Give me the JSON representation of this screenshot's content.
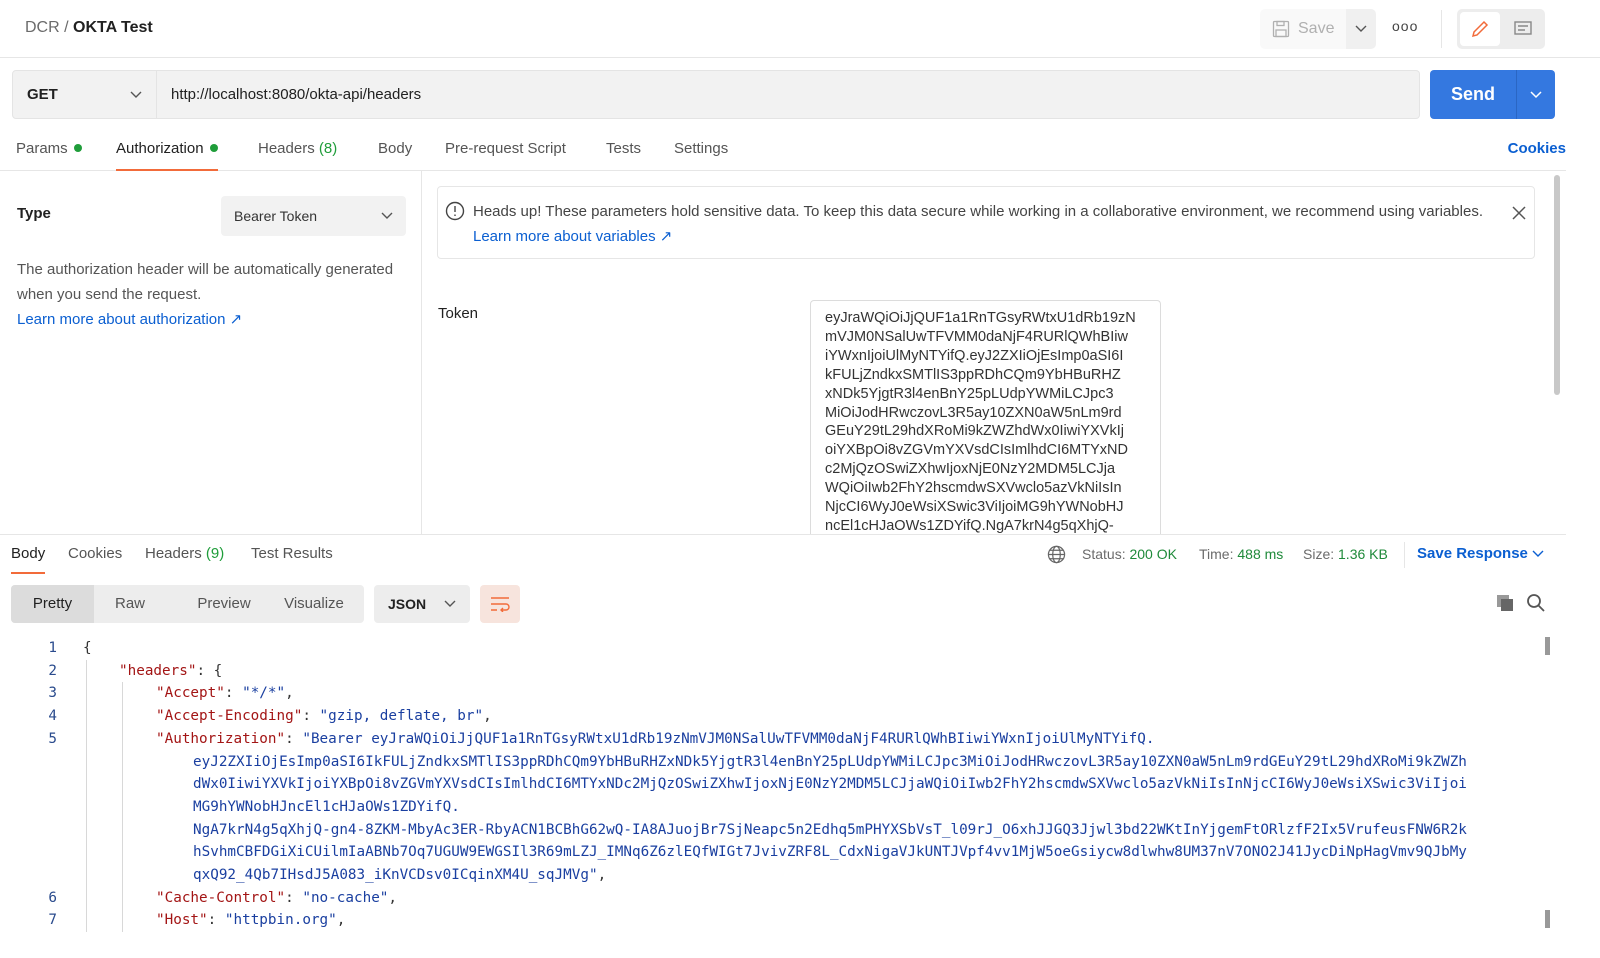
{
  "header": {
    "breadcrumb_parent": "DCR",
    "breadcrumb_sep": "/",
    "title": "OKTA Test",
    "save_label": "Save",
    "more_label": "ooo"
  },
  "request": {
    "method": "GET",
    "url": "http://localhost:8080/okta-api/headers",
    "send_label": "Send"
  },
  "tabs": [
    {
      "label": "Params",
      "dot": true
    },
    {
      "label": "Authorization",
      "dot": true,
      "active": true
    },
    {
      "label": "Headers",
      "count": "(8)"
    },
    {
      "label": "Body"
    },
    {
      "label": "Pre-request Script"
    },
    {
      "label": "Tests"
    },
    {
      "label": "Settings"
    }
  ],
  "cookies_label": "Cookies",
  "auth": {
    "type_label": "Type",
    "type_value": "Bearer Token",
    "description": "The authorization header will be automatically generated when you send the request.",
    "learn_more": "Learn more about authorization ↗",
    "alert_text": "Heads up! These parameters hold sensitive data. To keep this data secure while working in a collaborative environment, we recommend using variables.",
    "alert_link": "Learn more about variables ↗",
    "token_label": "Token",
    "token_lines": [
      "eyJraWQiOiJjQUF1a1RnTGsyRWtxU1dRb19zN",
      "mVJM0NSalUwTFVMM0daNjF4RURlQWhBIiw",
      "iYWxnIjoiUlMyNTYifQ.eyJ2ZXIiOjEsImp0aSI6I",
      "kFULjZndkxSMTlIS3ppRDhCQm9YbHBuRHZ",
      "xNDk5YjgtR3l4enBnY25pLUdpYWMiLCJpc3",
      "MiOiJodHRwczovL3R5ay10ZXN0aW5nLm9rd",
      "GEuY29tL29hdXRoMi9kZWZhdWx0IiwiYXVkIj",
      "oiYXBpOi8vZGVmYXVsdCIsImlhdCI6MTYxND",
      "c2MjQzOSwiZXhwIjoxNjE0NzY2MDM5LCJja",
      "WQiOiIwb2FhY2hscmdwSXVwclo5azVkNiIsIn",
      "NjcCI6WyJ0eWsiXSwic3ViIjoiMG9hYWNobHJ",
      "ncEl1cHJaOWs1ZDYifQ.NgA7krN4g5qXhjQ-"
    ]
  },
  "response": {
    "tabs": [
      {
        "label": "Body",
        "active": true
      },
      {
        "label": "Cookies"
      },
      {
        "label": "Headers",
        "count": "(9)"
      },
      {
        "label": "Test Results"
      }
    ],
    "status_label": "Status:",
    "status": "200 OK",
    "time_label": "Time:",
    "time": "488 ms",
    "size_label": "Size:",
    "size": "1.36 KB",
    "save_response": "Save Response",
    "views": [
      "Pretty",
      "Raw",
      "Preview",
      "Visualize"
    ],
    "format": "JSON",
    "lines": [
      {
        "n": "1",
        "parts": [
          [
            "pn",
            "{"
          ]
        ]
      },
      {
        "n": "2",
        "indent": 1,
        "parts": [
          [
            "k",
            "\"headers\""
          ],
          [
            "pn",
            ": {"
          ]
        ]
      },
      {
        "n": "3",
        "indent": 2,
        "parts": [
          [
            "k",
            "\"Accept\""
          ],
          [
            "pn",
            ": "
          ],
          [
            "s",
            "\"*/*\""
          ],
          [
            "pn",
            ","
          ]
        ]
      },
      {
        "n": "4",
        "indent": 2,
        "parts": [
          [
            "k",
            "\"Accept-Encoding\""
          ],
          [
            "pn",
            ": "
          ],
          [
            "s",
            "\"gzip, deflate, br\""
          ],
          [
            "pn",
            ","
          ]
        ]
      },
      {
        "n": "5",
        "indent": 2,
        "parts": [
          [
            "k",
            "\"Authorization\""
          ],
          [
            "pn",
            ": "
          ],
          [
            "s",
            "\"Bearer eyJraWQiOiJjQUF1a1RnTGsyRWtxU1dRb19zNmVJM0NSalUwTFVMM0daNjF4RURlQWhBIiwiYWxnIjoiUlMyNTYifQ."
          ]
        ]
      },
      {
        "n": "",
        "indent": 3,
        "parts": [
          [
            "s",
            "eyJ2ZXIiOjEsImp0aSI6IkFULjZndkxSMTlIS3ppRDhCQm9YbHBuRHZxNDk5YjgtR3l4enBnY25pLUdpYWMiLCJpc3MiOiJodHRwczovL3R5ay10ZXN0aW5nLm9rdGEuY29tL29hdXRoMi9kZWZh"
          ]
        ]
      },
      {
        "n": "",
        "indent": 3,
        "parts": [
          [
            "s",
            "dWx0IiwiYXVkIjoiYXBpOi8vZGVmYXVsdCIsImlhdCI6MTYxNDc2MjQzOSwiZXhwIjoxNjE0NzY2MDM5LCJjaWQiOiIwb2FhY2hscmdwSXVwclo5azVkNiIsInNjcCI6WyJ0eWsiXSwic3ViIjoi"
          ]
        ]
      },
      {
        "n": "",
        "indent": 3,
        "parts": [
          [
            "s",
            "MG9hYWNobHJncEl1cHJaOWs1ZDYifQ."
          ]
        ]
      },
      {
        "n": "",
        "indent": 3,
        "parts": [
          [
            "s",
            "NgA7krN4g5qXhjQ-gn4-8ZKM-MbyAc3ER-RbyACN1BCBhG62wQ-IA8AJuojBr7SjNeapc5n2Edhq5mPHYXSbVsT_l09rJ_O6xhJJGQ3Jjwl3bd22WKtInYjgemFtORlzfF2Ix5VrufeusFNW6R2k"
          ]
        ]
      },
      {
        "n": "",
        "indent": 3,
        "parts": [
          [
            "s",
            "hSvhmCBFDGiXiCUilmIaABNb7Oq7UGUW9EWGSIl3R69mLZJ_IMNq6Z6zlEQfWIGt7JvivZRF8L_CdxNigaVJkUNTJVpf4vv1MjW5oeGsiycw8dlwhw8UM37nV7ONO2J41JycDiNpHagVmv9QJbMy"
          ]
        ]
      },
      {
        "n": "",
        "indent": 3,
        "parts": [
          [
            "s",
            "qxQ92_4Qb7IHsdJ5A083_iKnVCDsv0ICqinXM4U_sqJMVg\""
          ],
          [
            "pn",
            ","
          ]
        ]
      },
      {
        "n": "6",
        "indent": 2,
        "parts": [
          [
            "k",
            "\"Cache-Control\""
          ],
          [
            "pn",
            ": "
          ],
          [
            "s",
            "\"no-cache\""
          ],
          [
            "pn",
            ","
          ]
        ]
      },
      {
        "n": "7",
        "indent": 2,
        "parts": [
          [
            "k",
            "\"Host\""
          ],
          [
            "pn",
            ": "
          ],
          [
            "s",
            "\"httpbin.org\""
          ],
          [
            "pn",
            ","
          ]
        ]
      }
    ]
  },
  "colors": {
    "accent": "#3478e0",
    "tab_underline": "#f26b3a",
    "success": "#1f8a3a",
    "link": "#0b5fd1"
  }
}
